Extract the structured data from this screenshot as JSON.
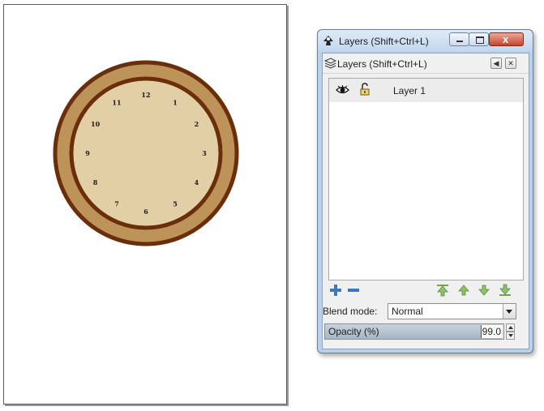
{
  "canvas": {
    "clock": {
      "numerals": [
        "12",
        "1",
        "2",
        "3",
        "4",
        "5",
        "6",
        "7",
        "8",
        "9",
        "10",
        "11"
      ],
      "colors": {
        "outer_ring": "#bd935a",
        "rim": "#6b2e0a",
        "face": "#e3cfa6"
      }
    }
  },
  "dialog": {
    "window_title": "Layers (Shift+Ctrl+L)",
    "dock_title": "Layers (Shift+Ctrl+L)",
    "close_glyph": "x",
    "layers": [
      {
        "name": "Layer 1",
        "visible": true,
        "locked": false
      }
    ],
    "blend": {
      "label": "Blend mode:",
      "value": "Normal"
    },
    "opacity": {
      "label": "Opacity (%)",
      "value": "99.0",
      "fraction": 0.99
    }
  }
}
